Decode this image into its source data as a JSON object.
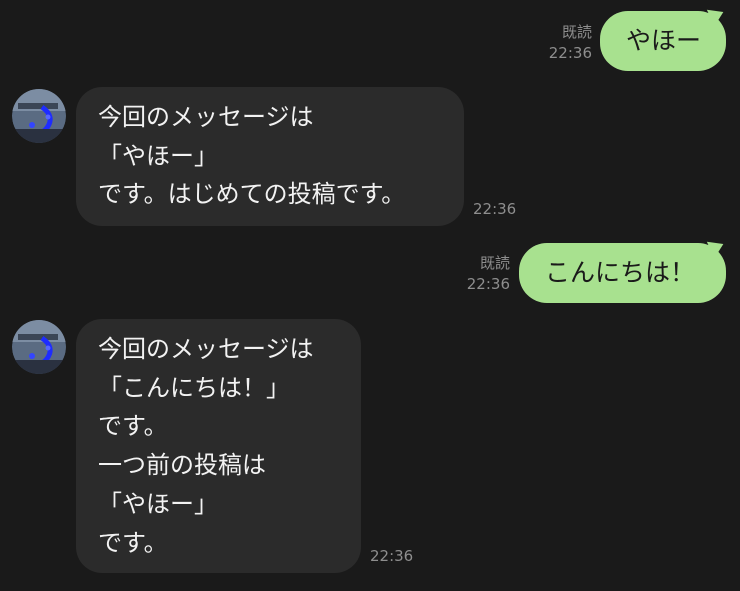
{
  "messages": [
    {
      "direction": "out",
      "text": "やほー",
      "read_label": "既読",
      "time": "22:36"
    },
    {
      "direction": "in",
      "text": "今回のメッセージは\n「やほー」\nです。はじめての投稿です。",
      "time": "22:36",
      "avatar_icon": "profile-avatar-icon"
    },
    {
      "direction": "out",
      "text": "こんにちは！",
      "read_label": "既読",
      "time": "22:36"
    },
    {
      "direction": "in",
      "text": "今回のメッセージは\n「こんにちは！」\nです。\n一つ前の投稿は\n「やほー」\nです。",
      "time": "22:36",
      "avatar_icon": "profile-avatar-icon"
    }
  ],
  "colors": {
    "background": "#1a1a1a",
    "outgoing_bubble": "#a8e18f",
    "incoming_bubble": "#2b2b2b",
    "incoming_text": "#f2f2f2",
    "meta_text": "#8e8e8e"
  }
}
